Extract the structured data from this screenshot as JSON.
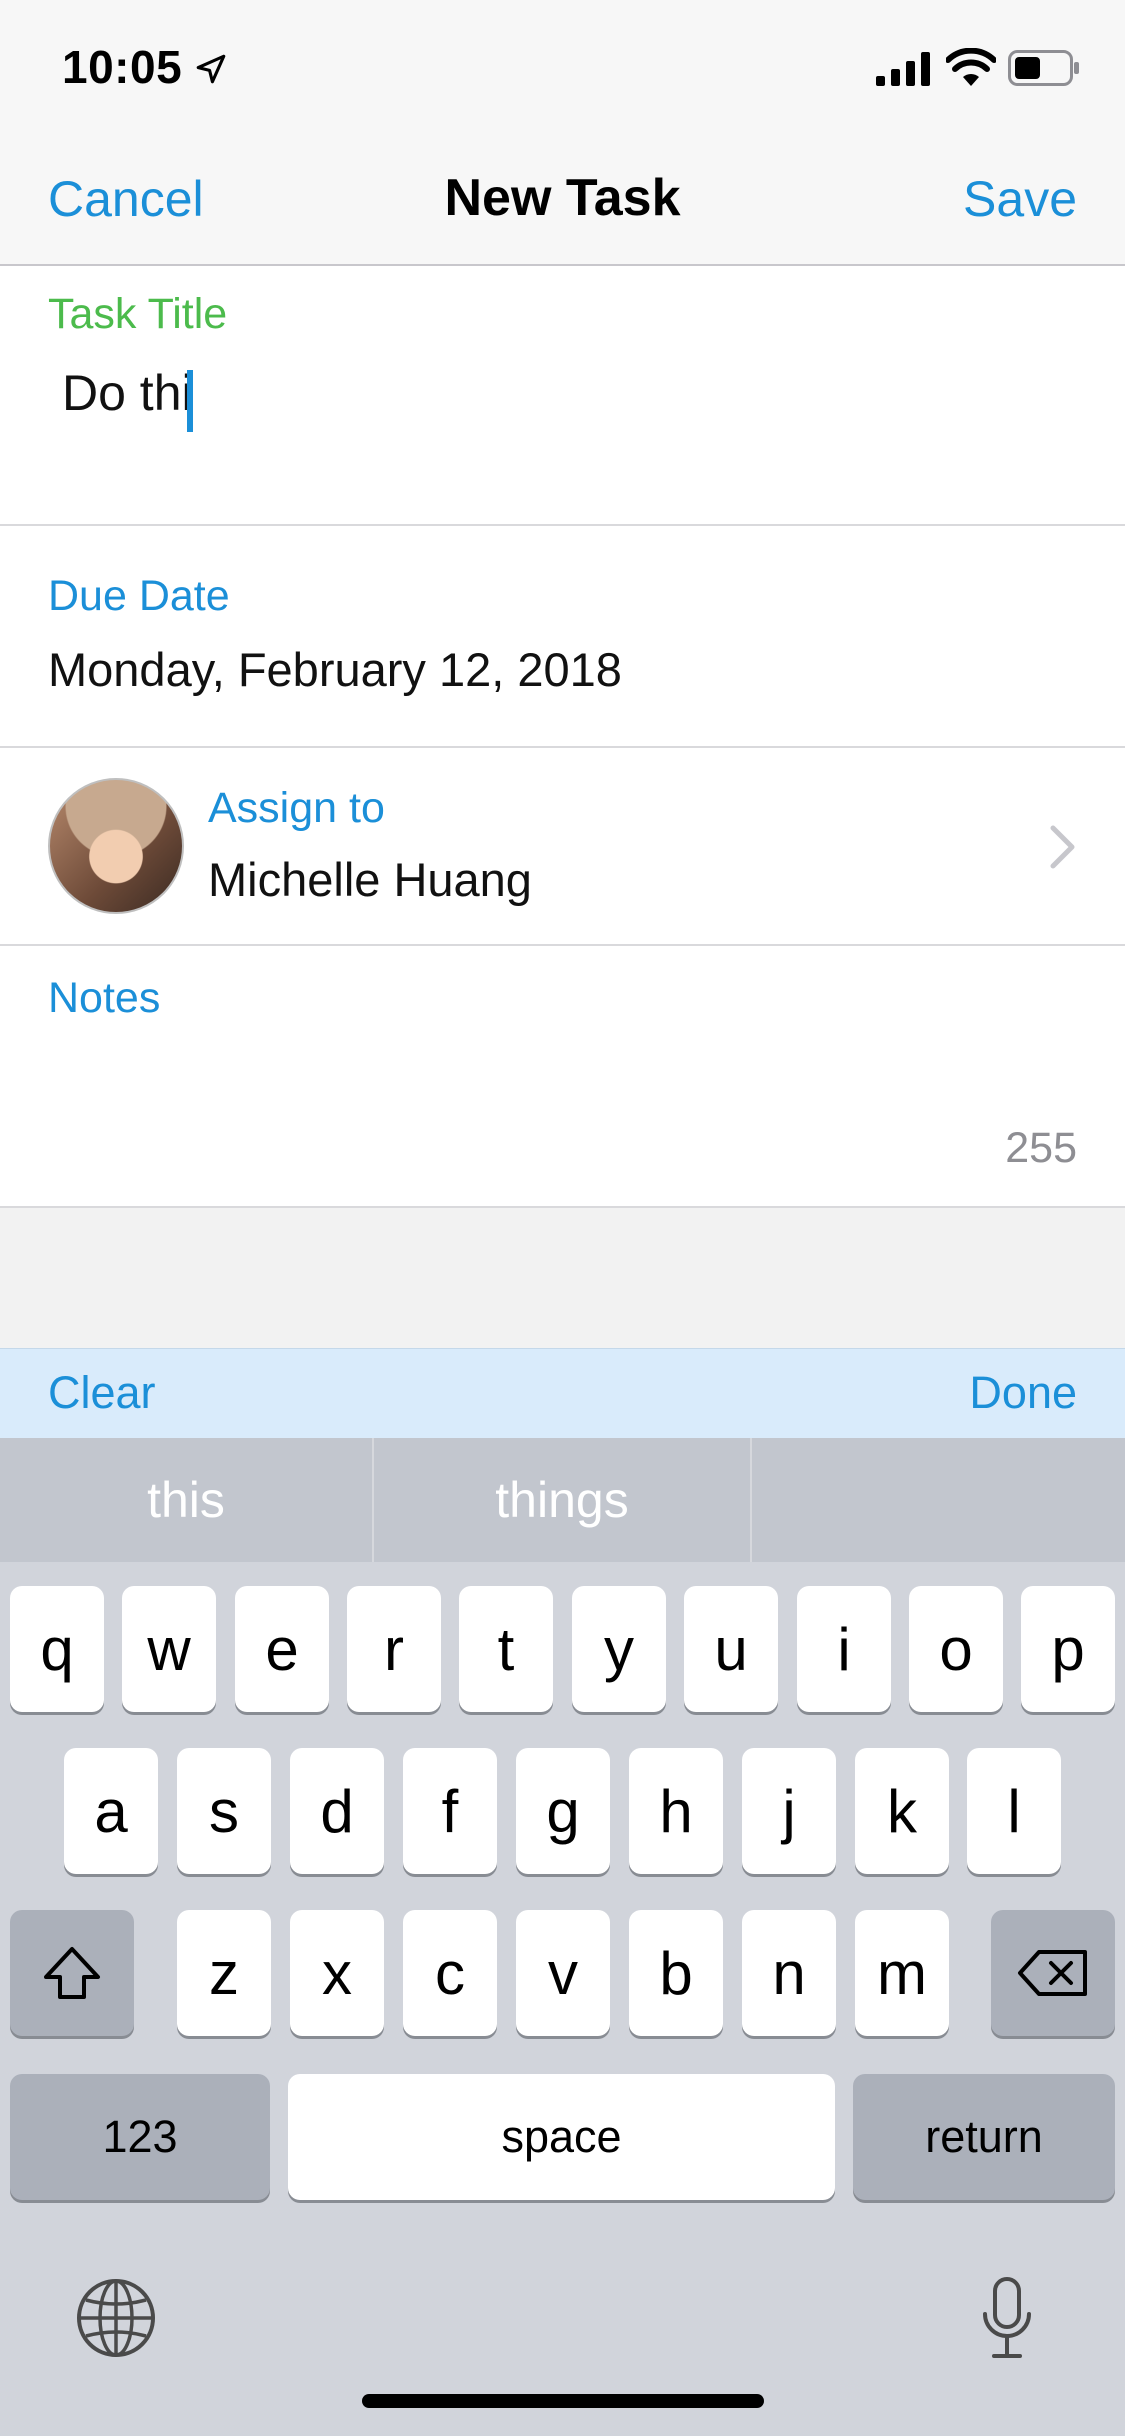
{
  "status_bar": {
    "time": "10:05",
    "icons": [
      "location-arrow-icon",
      "cellular-signal-icon",
      "wifi-icon",
      "battery-icon"
    ]
  },
  "nav": {
    "cancel_label": "Cancel",
    "title": "New Task",
    "save_label": "Save"
  },
  "form": {
    "task_title": {
      "label": "Task Title",
      "value": "Do thi"
    },
    "due_date": {
      "label": "Due Date",
      "value": "Monday, February 12, 2018"
    },
    "assign": {
      "label": "Assign to",
      "value": "Michelle Huang"
    },
    "notes": {
      "label": "Notes",
      "remaining": "255"
    }
  },
  "accessory": {
    "clear_label": "Clear",
    "done_label": "Done"
  },
  "keyboard": {
    "suggestions": [
      "this",
      "things",
      ""
    ],
    "row1": [
      "q",
      "w",
      "e",
      "r",
      "t",
      "y",
      "u",
      "i",
      "o",
      "p"
    ],
    "row2": [
      "a",
      "s",
      "d",
      "f",
      "g",
      "h",
      "j",
      "k",
      "l"
    ],
    "row3": [
      "z",
      "x",
      "c",
      "v",
      "b",
      "n",
      "m"
    ],
    "numbers_label": "123",
    "space_label": "space",
    "return_label": "return"
  },
  "colors": {
    "accent": "#1b8fd8",
    "active_label": "#4cbb4c",
    "accessory_bg": "#d9ebfb",
    "keyboard_bg": "#d1d4db"
  }
}
